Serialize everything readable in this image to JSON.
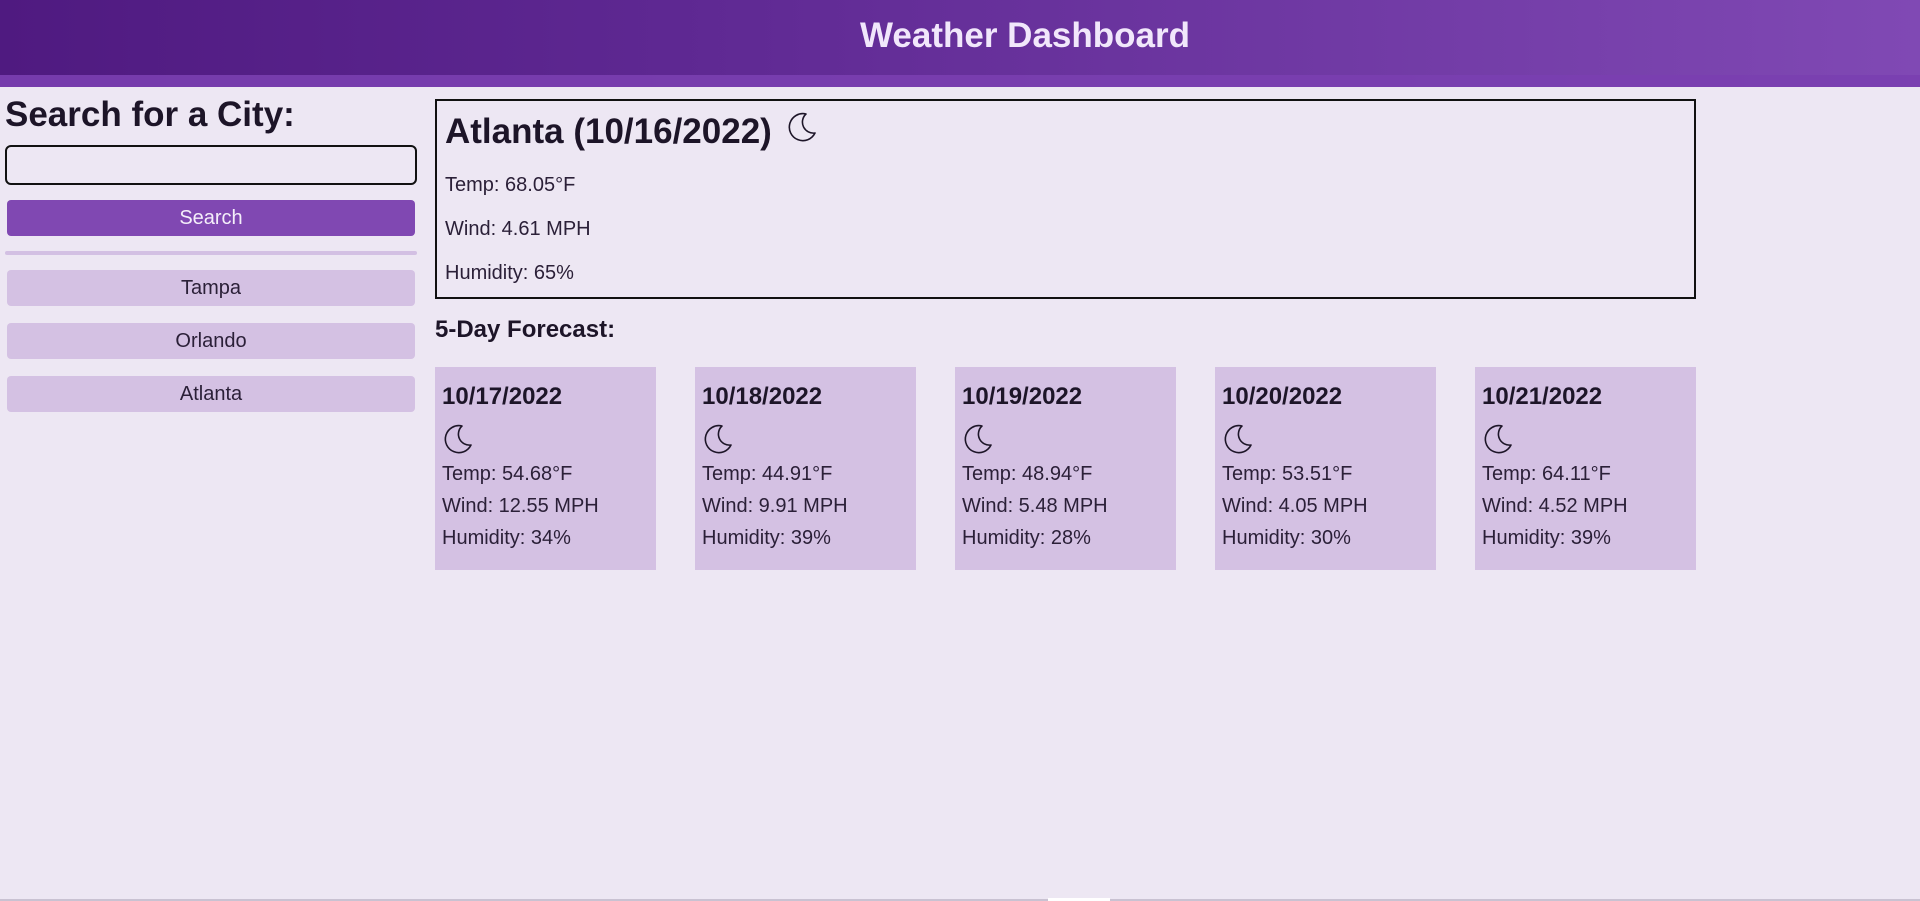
{
  "header": {
    "title": "Weather Dashboard"
  },
  "search": {
    "heading": "Search for a City:",
    "input_value": "",
    "placeholder": "",
    "button_label": "Search"
  },
  "history": [
    {
      "label": "Tampa"
    },
    {
      "label": "Orlando"
    },
    {
      "label": "Atlanta"
    }
  ],
  "current": {
    "title": "Atlanta (10/16/2022)",
    "icon": "moon-icon",
    "temp": "Temp: 68.05°F",
    "wind": "Wind: 4.61 MPH",
    "humidity": "Humidity: 65%"
  },
  "forecast": {
    "heading": "5-Day Forecast:",
    "days": [
      {
        "date": "10/17/2022",
        "icon": "moon-icon",
        "temp": "Temp: 54.68°F",
        "wind": "Wind: 12.55 MPH",
        "humidity": "Humidity: 34%"
      },
      {
        "date": "10/18/2022",
        "icon": "moon-icon",
        "temp": "Temp: 44.91°F",
        "wind": "Wind: 9.91 MPH",
        "humidity": "Humidity: 39%"
      },
      {
        "date": "10/19/2022",
        "icon": "moon-icon",
        "temp": "Temp: 48.94°F",
        "wind": "Wind: 5.48 MPH",
        "humidity": "Humidity: 28%"
      },
      {
        "date": "10/20/2022",
        "icon": "moon-icon",
        "temp": "Temp: 53.51°F",
        "wind": "Wind: 4.05 MPH",
        "humidity": "Humidity: 30%"
      },
      {
        "date": "10/21/2022",
        "icon": "moon-icon",
        "temp": "Temp: 64.11°F",
        "wind": "Wind: 4.52 MPH",
        "humidity": "Humidity: 39%"
      }
    ]
  },
  "colors": {
    "background": "#ede7f3",
    "header_start": "#4f1a80",
    "header_end": "#8049b4",
    "accent_button": "#8048b2",
    "secondary_button": "#d4c1e3",
    "forecast_card": "#d4c1e3"
  }
}
